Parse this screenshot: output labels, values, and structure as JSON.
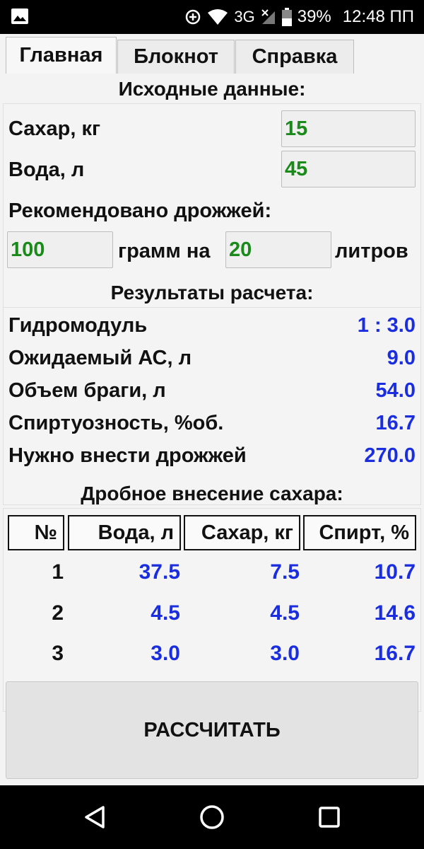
{
  "status_bar": {
    "battery": "39%",
    "time": "12:48 ПП",
    "network": "3G"
  },
  "tabs": [
    {
      "label": "Главная",
      "active": true
    },
    {
      "label": "Блокнот",
      "active": false
    },
    {
      "label": "Справка",
      "active": false
    }
  ],
  "input": {
    "title": "Исходные данные:",
    "sugar_label": "Сахар, кг",
    "sugar_value": "15",
    "water_label": "Вода, л",
    "water_value": "45",
    "yeast_label": "Рекомендовано дрожжей:",
    "yeast_grams": "100",
    "yeast_mid": "грамм на",
    "yeast_liters": "20",
    "yeast_unit": "литров"
  },
  "results": {
    "title": "Результаты расчета:",
    "rows": [
      {
        "label": "Гидромодуль",
        "value": "1 : 3.0"
      },
      {
        "label": "Ожидаемый АС, л",
        "value": "9.0"
      },
      {
        "label": "Объем браги, л",
        "value": "54.0"
      },
      {
        "label": "Спиртуозность, %об.",
        "value": "16.7"
      },
      {
        "label": "Нужно внести дрожжей",
        "value": "270.0"
      }
    ]
  },
  "fractional": {
    "title": "Дробное внесение сахара:",
    "headers": [
      "№",
      "Вода, л",
      "Сахар, кг",
      "Спирт, %"
    ],
    "rows": [
      {
        "n": "1",
        "water": "37.5",
        "sugar": "7.5",
        "spirit": "10.7"
      },
      {
        "n": "2",
        "water": "4.5",
        "sugar": "4.5",
        "spirit": "14.6"
      },
      {
        "n": "3",
        "water": "3.0",
        "sugar": "3.0",
        "spirit": "16.7"
      }
    ]
  },
  "calculate_label": "РАССЧИТАТЬ",
  "colors": {
    "input_value": "#1a8a1a",
    "result_value": "#1a2ee0"
  }
}
